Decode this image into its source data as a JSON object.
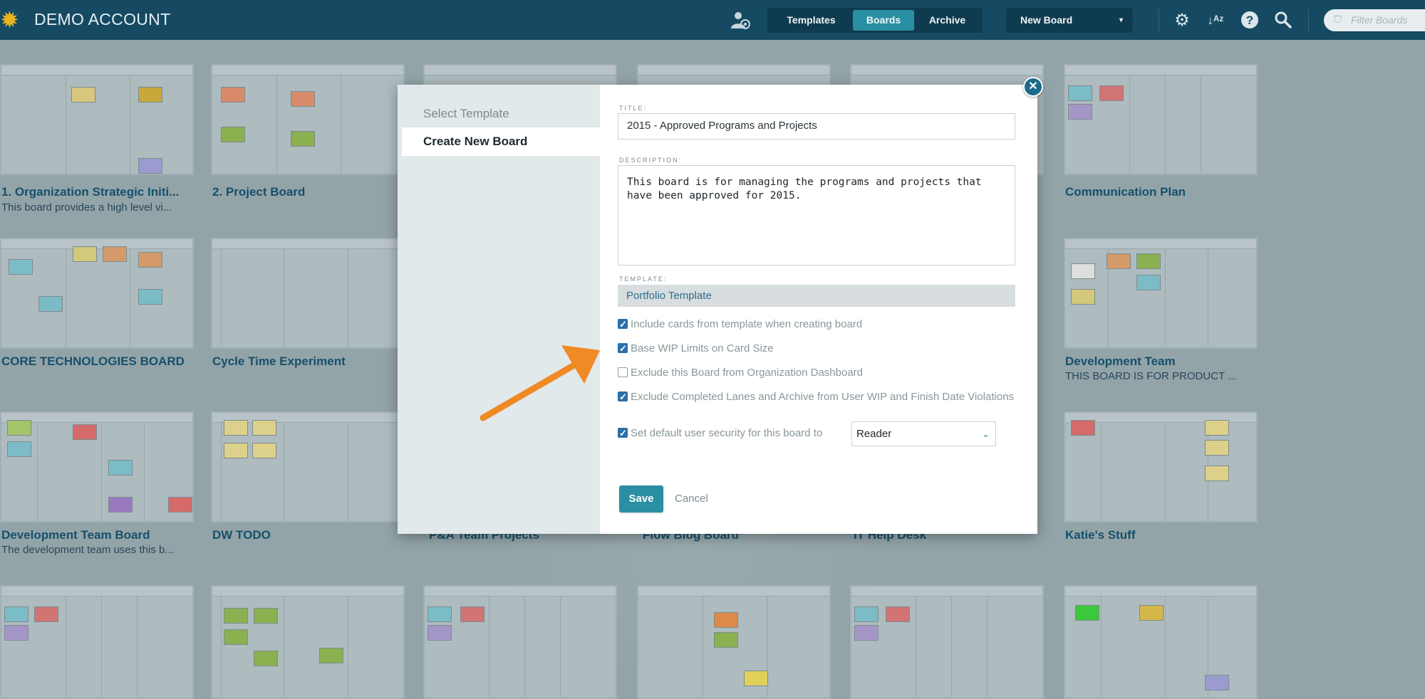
{
  "header": {
    "account_name": "DEMO ACCOUNT",
    "tabs": [
      {
        "label": "Templates",
        "active": false
      },
      {
        "label": "Boards",
        "active": true
      },
      {
        "label": "Archive",
        "active": false
      }
    ],
    "new_board_label": "New Board",
    "filter_placeholder": "Filter Boards",
    "icons": [
      "gear-icon",
      "sort-az-icon",
      "help-icon",
      "search-icon"
    ]
  },
  "boards": [
    {
      "name": "1. Organization Strategic Initi...",
      "description": "This board provides a high level vi..."
    },
    {
      "name": "2. Project Board",
      "description": ""
    },
    {
      "name": "Communication Plan",
      "description": ""
    },
    {
      "name": "CORE TECHNOLOGIES BOARD",
      "description": ""
    },
    {
      "name": "Cycle Time Experiment",
      "description": ""
    },
    {
      "name": "Development Team",
      "description": "THIS BOARD IS FOR PRODUCT ..."
    },
    {
      "name": "Development Team Board",
      "description": "The development team uses this b..."
    },
    {
      "name": "DW TODO",
      "description": ""
    },
    {
      "name": "P&A Team Projects",
      "description": ""
    },
    {
      "name": "Flow Blog Board",
      "description": ""
    },
    {
      "name": "IT Help Desk",
      "description": ""
    },
    {
      "name": "Katie's Stuff",
      "description": ""
    }
  ],
  "modal": {
    "side_items": [
      "Select Template",
      "Create New Board"
    ],
    "title_label": "TITLE:",
    "title_value": "2015 - Approved Programs and Projects",
    "description_label": "DESCRIPTION:",
    "description_value": "This board is for managing the programs and projects that\nhave been approved for 2015.",
    "template_label": "TEMPLATE:",
    "template_value": "Portfolio Template",
    "options": [
      {
        "label": "Include cards from template when creating board",
        "checked": true
      },
      {
        "label": "Base WIP Limits on Card Size",
        "checked": true
      },
      {
        "label": "Exclude this Board from Organization Dashboard",
        "checked": false
      },
      {
        "label": "Exclude Completed Lanes and Archive from User WIP and Finish Date Violations",
        "checked": true
      },
      {
        "label": "Set default user security for this board to",
        "checked": true
      }
    ],
    "security_value": "Reader",
    "save_label": "Save",
    "cancel_label": "Cancel"
  },
  "colors": {
    "topbar": "#154a62",
    "accent": "#2b8fa4",
    "arrow": "#f08a24",
    "checkbox": "#2b6fa8"
  }
}
